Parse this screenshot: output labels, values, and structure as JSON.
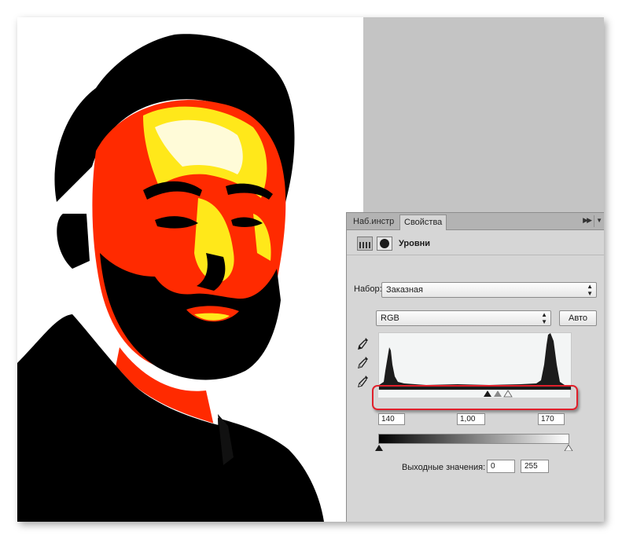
{
  "panel": {
    "tabs": [
      {
        "label": "Наб.инстр",
        "active": false
      },
      {
        "label": "Свойства",
        "active": true
      }
    ],
    "collapse_icon": "double-chevron-right-icon",
    "menu_icon": "panel-menu-icon",
    "adjustment_title": "Уровни",
    "preset_label": "Набор:",
    "preset_value": "Заказная",
    "channel_value": "RGB",
    "auto_label": "Авто",
    "input_black": "140",
    "input_gamma": "1,00",
    "input_white": "170",
    "output_label": "Выходные значения:",
    "output_black": "0",
    "output_white": "255"
  },
  "colors": {
    "highlight_border": "#e0202b",
    "panel_bg": "#d6d6d6",
    "canvas_bg": "#c4c4c4"
  },
  "icons": [
    "histogram-icon",
    "mask-icon",
    "black-eyedropper-icon",
    "gray-eyedropper-icon",
    "white-eyedropper-icon"
  ]
}
